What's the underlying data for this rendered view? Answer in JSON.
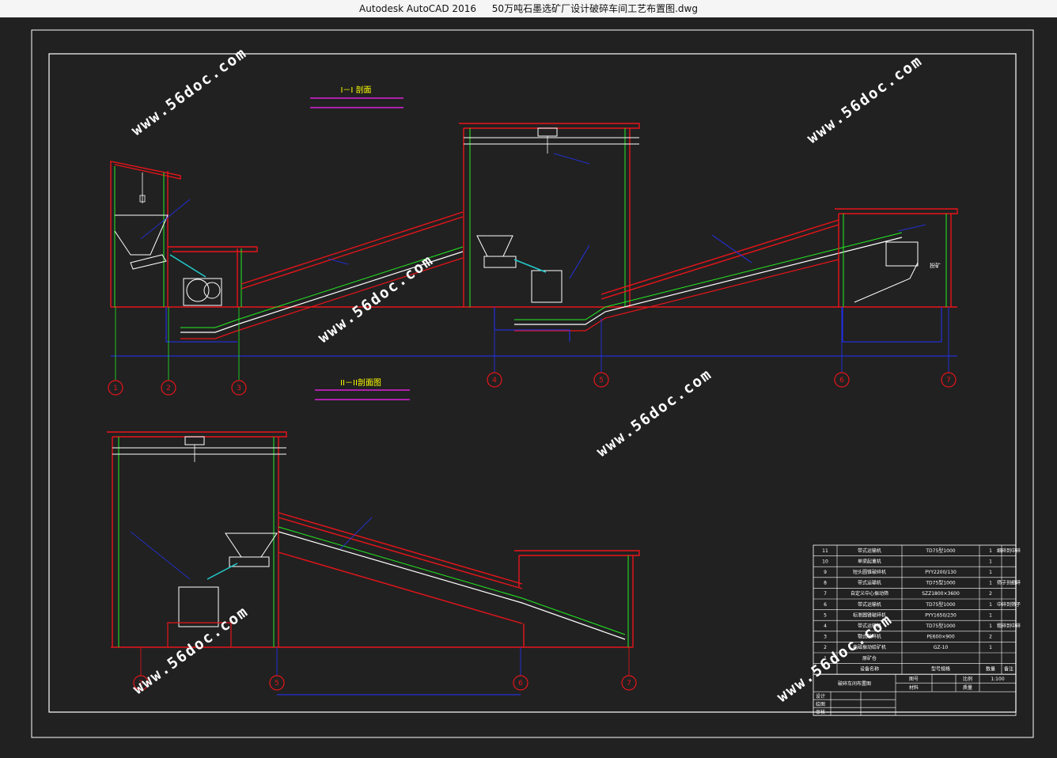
{
  "window": {
    "app_title": "Autodesk AutoCAD 2016",
    "file_name": "50万吨石墨选矿厂设计破碎车间工艺布置图.dwg"
  },
  "drawing": {
    "section1_title": "I－I 剖面",
    "section2_title": "II－II剖面图",
    "annotation_fenkuang": "扮矿",
    "axis_labels_top": [
      "1",
      "2",
      "3",
      "4",
      "5",
      "6",
      "7"
    ],
    "axis_labels_bottom": [
      "2",
      "5",
      "6",
      "7"
    ],
    "watermark": "www.56doc.com"
  },
  "parts_table": {
    "rows": [
      {
        "no": "11",
        "name": "带式运输机",
        "spec": "TD75型1000",
        "qty": "1",
        "note": "细碎到中碎"
      },
      {
        "no": "10",
        "name": "单梁起重机",
        "spec": "",
        "qty": "1",
        "note": ""
      },
      {
        "no": "9",
        "name": "短头圆锥破碎机",
        "spec": "PYY2200/130",
        "qty": "1",
        "note": ""
      },
      {
        "no": "8",
        "name": "带式运输机",
        "spec": "TD75型1000",
        "qty": "1",
        "note": "筛子到细碎"
      },
      {
        "no": "7",
        "name": "自定义中心振动筛",
        "spec": "SZZ1800×3600",
        "qty": "2",
        "note": ""
      },
      {
        "no": "6",
        "name": "带式运输机",
        "spec": "TD75型1000",
        "qty": "1",
        "note": "中碎到筛子"
      },
      {
        "no": "5",
        "name": "标准圆锥破碎机",
        "spec": "PYY1650/230",
        "qty": "1",
        "note": ""
      },
      {
        "no": "4",
        "name": "带式运输机",
        "spec": "TD75型1000",
        "qty": "1",
        "note": "粗碎到中碎"
      },
      {
        "no": "3",
        "name": "颚式破碎机",
        "spec": "PE600×900",
        "qty": "2",
        "note": ""
      },
      {
        "no": "2",
        "name": "电磁振动给矿机",
        "spec": "GZ-10",
        "qty": "1",
        "note": ""
      },
      {
        "no": "1",
        "name": "原矿仓",
        "spec": "",
        "qty": "",
        "note": ""
      }
    ],
    "header": {
      "col_no": "",
      "col_name": "设备名称",
      "col_spec": "型号规格",
      "col_qty": "数量",
      "col_note": "备注"
    },
    "title_block": {
      "drawing_name": "破碎车间布置图",
      "label_drawing_no": "图号",
      "label_material": "材料",
      "label_scale": "比例",
      "scale_value": "1:100",
      "label_mass": "质量",
      "roles": [
        "设计",
        "绘图",
        "审核"
      ]
    }
  },
  "colors": {
    "wall": "#e8141a",
    "line": "#ffffff",
    "green": "#22ee22",
    "blue": "#2233ff",
    "cyan": "#22cccc",
    "magenta": "#ff22ff",
    "yellow": "#ffff00"
  }
}
